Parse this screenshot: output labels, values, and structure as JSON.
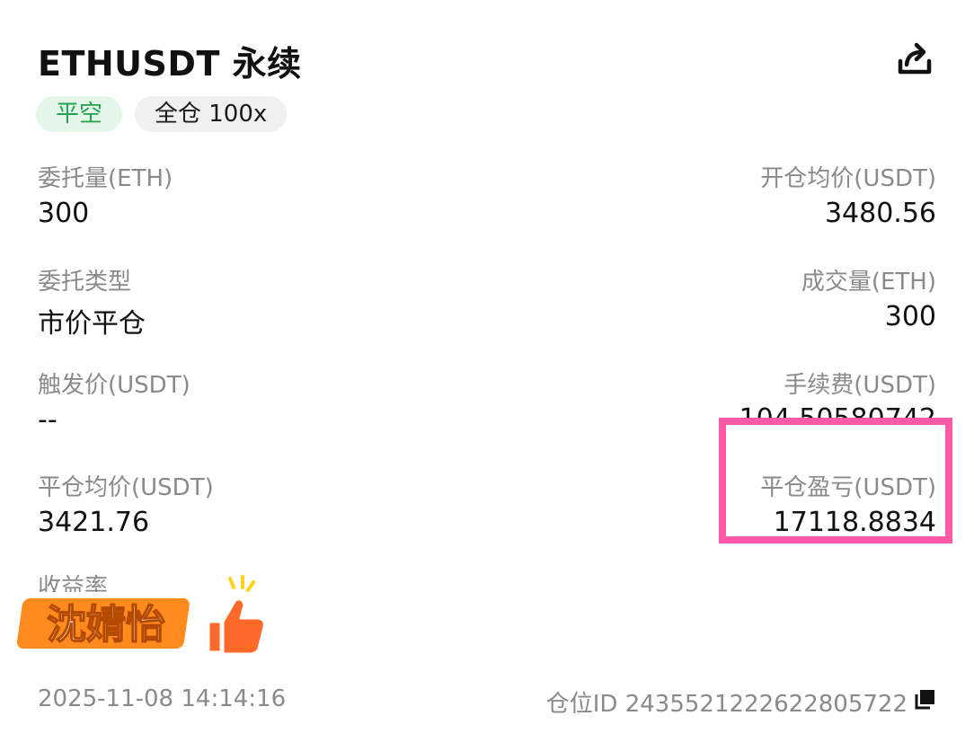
{
  "header": {
    "title": "ETHUSDT 永续",
    "share_icon": "share-icon"
  },
  "tags": {
    "side": "平空",
    "margin": "全仓 100x"
  },
  "fields": {
    "order_qty_label": "委托量(ETH)",
    "order_qty_value": "300",
    "open_avg_label": "开仓均价(USDT)",
    "open_avg_value": "3480.56",
    "order_type_label": "委托类型",
    "order_type_value": "市价平仓",
    "filled_qty_label": "成交量(ETH)",
    "filled_qty_value": "300",
    "trigger_price_label": "触发价(USDT)",
    "trigger_price_value": "--",
    "fee_label": "手续费(USDT)",
    "fee_value": "104.50580742",
    "close_avg_label": "平仓均价(USDT)",
    "close_avg_value": "3421.76",
    "close_pnl_label": "平仓盈亏(USDT)",
    "close_pnl_value": "17118.8834",
    "return_rate_label": "收益率"
  },
  "sticker": {
    "text": "沈婧怡",
    "icon": "thumbs-up-icon"
  },
  "footer": {
    "time": "2025-11-08  14:14:16",
    "position_id": "仓位ID 2435521222622805722",
    "copy_icon": "copy-icon"
  },
  "colors": {
    "tag_side_bg": "#e4f6ea",
    "tag_side_text": "#25a24f",
    "highlight_border": "#ff5aa8",
    "sticker_fill": "#ff8a1e"
  }
}
